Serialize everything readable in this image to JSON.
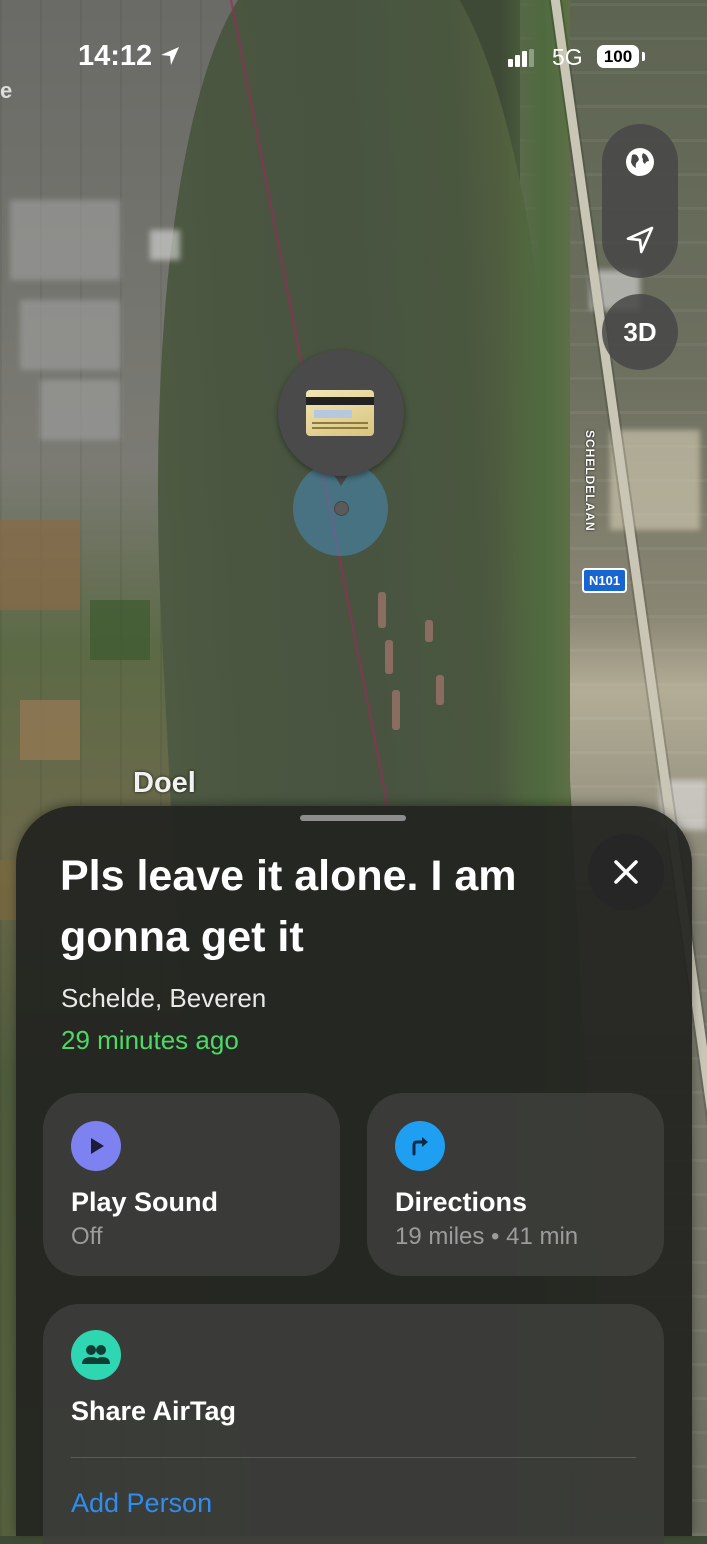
{
  "status_bar": {
    "time": "14:12",
    "network": "5G",
    "battery": "100"
  },
  "map": {
    "city_label": "Doel",
    "edge_letter": "e",
    "road_label": "SCHELDELAAN",
    "road_shield": "N101",
    "controls": {
      "globe_icon": "globe-icon",
      "location_icon": "location-arrow-icon",
      "three_d_label": "3D"
    }
  },
  "item": {
    "icon": "credit-card-icon",
    "title": "Pls leave it alone. I am gonna get it",
    "location": "Schelde, Beveren",
    "last_seen": "29 minutes ago"
  },
  "actions": {
    "play_sound": {
      "label": "Play Sound",
      "sub": "Off",
      "icon": "play-icon",
      "color": "#7d82f0"
    },
    "directions": {
      "label": "Directions",
      "sub": "19 miles • 41 min",
      "icon": "turn-right-arrow-icon",
      "color": "#1e9ff2"
    }
  },
  "share": {
    "label": "Share AirTag",
    "icon": "people-icon",
    "color": "#2fd6b2",
    "add_person": "Add Person"
  }
}
